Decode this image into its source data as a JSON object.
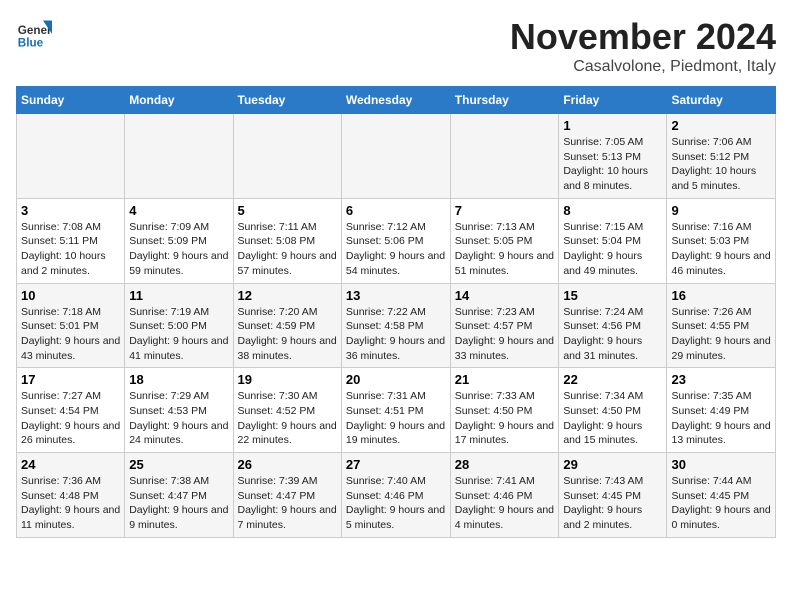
{
  "header": {
    "logo_general": "General",
    "logo_blue": "Blue",
    "month_title": "November 2024",
    "location": "Casalvolone, Piedmont, Italy"
  },
  "days_of_week": [
    "Sunday",
    "Monday",
    "Tuesday",
    "Wednesday",
    "Thursday",
    "Friday",
    "Saturday"
  ],
  "weeks": [
    [
      {
        "day": "",
        "details": ""
      },
      {
        "day": "",
        "details": ""
      },
      {
        "day": "",
        "details": ""
      },
      {
        "day": "",
        "details": ""
      },
      {
        "day": "",
        "details": ""
      },
      {
        "day": "1",
        "details": "Sunrise: 7:05 AM\nSunset: 5:13 PM\nDaylight: 10 hours and 8 minutes."
      },
      {
        "day": "2",
        "details": "Sunrise: 7:06 AM\nSunset: 5:12 PM\nDaylight: 10 hours and 5 minutes."
      }
    ],
    [
      {
        "day": "3",
        "details": "Sunrise: 7:08 AM\nSunset: 5:11 PM\nDaylight: 10 hours and 2 minutes."
      },
      {
        "day": "4",
        "details": "Sunrise: 7:09 AM\nSunset: 5:09 PM\nDaylight: 9 hours and 59 minutes."
      },
      {
        "day": "5",
        "details": "Sunrise: 7:11 AM\nSunset: 5:08 PM\nDaylight: 9 hours and 57 minutes."
      },
      {
        "day": "6",
        "details": "Sunrise: 7:12 AM\nSunset: 5:06 PM\nDaylight: 9 hours and 54 minutes."
      },
      {
        "day": "7",
        "details": "Sunrise: 7:13 AM\nSunset: 5:05 PM\nDaylight: 9 hours and 51 minutes."
      },
      {
        "day": "8",
        "details": "Sunrise: 7:15 AM\nSunset: 5:04 PM\nDaylight: 9 hours and 49 minutes."
      },
      {
        "day": "9",
        "details": "Sunrise: 7:16 AM\nSunset: 5:03 PM\nDaylight: 9 hours and 46 minutes."
      }
    ],
    [
      {
        "day": "10",
        "details": "Sunrise: 7:18 AM\nSunset: 5:01 PM\nDaylight: 9 hours and 43 minutes."
      },
      {
        "day": "11",
        "details": "Sunrise: 7:19 AM\nSunset: 5:00 PM\nDaylight: 9 hours and 41 minutes."
      },
      {
        "day": "12",
        "details": "Sunrise: 7:20 AM\nSunset: 4:59 PM\nDaylight: 9 hours and 38 minutes."
      },
      {
        "day": "13",
        "details": "Sunrise: 7:22 AM\nSunset: 4:58 PM\nDaylight: 9 hours and 36 minutes."
      },
      {
        "day": "14",
        "details": "Sunrise: 7:23 AM\nSunset: 4:57 PM\nDaylight: 9 hours and 33 minutes."
      },
      {
        "day": "15",
        "details": "Sunrise: 7:24 AM\nSunset: 4:56 PM\nDaylight: 9 hours and 31 minutes."
      },
      {
        "day": "16",
        "details": "Sunrise: 7:26 AM\nSunset: 4:55 PM\nDaylight: 9 hours and 29 minutes."
      }
    ],
    [
      {
        "day": "17",
        "details": "Sunrise: 7:27 AM\nSunset: 4:54 PM\nDaylight: 9 hours and 26 minutes."
      },
      {
        "day": "18",
        "details": "Sunrise: 7:29 AM\nSunset: 4:53 PM\nDaylight: 9 hours and 24 minutes."
      },
      {
        "day": "19",
        "details": "Sunrise: 7:30 AM\nSunset: 4:52 PM\nDaylight: 9 hours and 22 minutes."
      },
      {
        "day": "20",
        "details": "Sunrise: 7:31 AM\nSunset: 4:51 PM\nDaylight: 9 hours and 19 minutes."
      },
      {
        "day": "21",
        "details": "Sunrise: 7:33 AM\nSunset: 4:50 PM\nDaylight: 9 hours and 17 minutes."
      },
      {
        "day": "22",
        "details": "Sunrise: 7:34 AM\nSunset: 4:50 PM\nDaylight: 9 hours and 15 minutes."
      },
      {
        "day": "23",
        "details": "Sunrise: 7:35 AM\nSunset: 4:49 PM\nDaylight: 9 hours and 13 minutes."
      }
    ],
    [
      {
        "day": "24",
        "details": "Sunrise: 7:36 AM\nSunset: 4:48 PM\nDaylight: 9 hours and 11 minutes."
      },
      {
        "day": "25",
        "details": "Sunrise: 7:38 AM\nSunset: 4:47 PM\nDaylight: 9 hours and 9 minutes."
      },
      {
        "day": "26",
        "details": "Sunrise: 7:39 AM\nSunset: 4:47 PM\nDaylight: 9 hours and 7 minutes."
      },
      {
        "day": "27",
        "details": "Sunrise: 7:40 AM\nSunset: 4:46 PM\nDaylight: 9 hours and 5 minutes."
      },
      {
        "day": "28",
        "details": "Sunrise: 7:41 AM\nSunset: 4:46 PM\nDaylight: 9 hours and 4 minutes."
      },
      {
        "day": "29",
        "details": "Sunrise: 7:43 AM\nSunset: 4:45 PM\nDaylight: 9 hours and 2 minutes."
      },
      {
        "day": "30",
        "details": "Sunrise: 7:44 AM\nSunset: 4:45 PM\nDaylight: 9 hours and 0 minutes."
      }
    ]
  ]
}
